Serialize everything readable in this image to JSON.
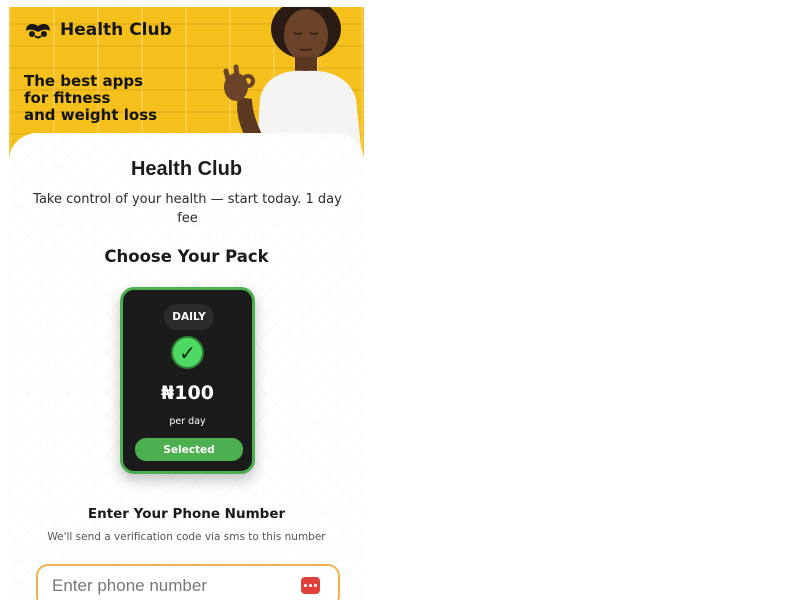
{
  "banner": {
    "logo_text": "Health Club",
    "tagline": [
      "The best apps",
      "for fitness",
      "and weight loss"
    ]
  },
  "header": {
    "title": "Health Club",
    "subtitle": "Take control of your health — start today. 1 day fee"
  },
  "packs": {
    "heading": "Choose Your Pack",
    "selected": {
      "badge": "DAILY",
      "price": "₦100",
      "period": "per day",
      "status": "Selected"
    }
  },
  "phone": {
    "heading": "Enter Your Phone Number",
    "note": "We'll send a verification code via sms to this number",
    "placeholder": "Enter phone number",
    "value": ""
  },
  "colors": {
    "banner_yellow": "#f8c21a",
    "accent_green": "#4caf50",
    "card_dark": "#1b1b1b",
    "field_border": "#f0b24a",
    "keys_icon_red": "#e0403a"
  },
  "icons": {
    "logo": "health-club-logo-icon",
    "check": "check-circle-icon",
    "keys": "password-keys-icon"
  }
}
